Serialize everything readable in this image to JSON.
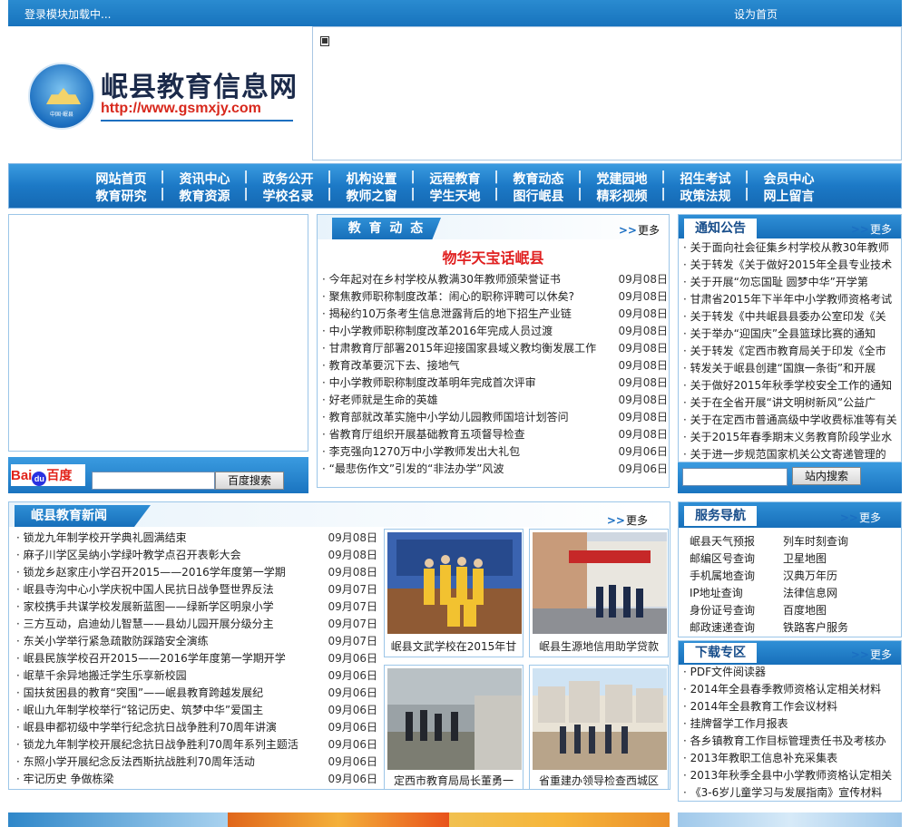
{
  "topbar": {
    "login_status": "登录模块加载中...",
    "set_home": "设为首页"
  },
  "site": {
    "title": "岷县教育信息网",
    "url": "http://www.gsmxjy.com",
    "emblem_text": "中国·岷县"
  },
  "nav": {
    "row1": [
      "网站首页",
      "资讯中心",
      "政务公开",
      "机构设置",
      "远程教育",
      "教育动态",
      "党建园地",
      "招生考试",
      "会员中心"
    ],
    "row2": [
      "教育研究",
      "教育资源",
      "学校名录",
      "教师之窗",
      "学生天地",
      "图行岷县",
      "精彩视频",
      "政策法规",
      "网上留言"
    ]
  },
  "search": {
    "baidu_button": "百度搜索",
    "site_button": "站内搜索",
    "baidu_logo_a": "Bai",
    "baidu_logo_b": "百度"
  },
  "dynamics": {
    "title": "教 育 动 态",
    "more": "更多",
    "headline": "物华天宝话岷县",
    "items": [
      {
        "t": "今年起对在乡村学校从教满30年教师颁荣誉证书",
        "d": "09月08日"
      },
      {
        "t": "聚焦教师职称制度改革：闹心的职称评聘可以休矣?",
        "d": "09月08日"
      },
      {
        "t": "揭秘约10万条考生信息泄露背后的地下招生产业链",
        "d": "09月08日"
      },
      {
        "t": "中小学教师职称制度改革2016年完成人员过渡",
        "d": "09月08日"
      },
      {
        "t": "甘肃教育厅部署2015年迎接国家县域义教均衡发展工作",
        "d": "09月08日"
      },
      {
        "t": "教育改革要沉下去、接地气",
        "d": "09月08日"
      },
      {
        "t": "中小学教师职称制度改革明年完成首次评审",
        "d": "09月08日"
      },
      {
        "t": "好老师就是生命的英雄",
        "d": "09月08日"
      },
      {
        "t": "教育部就改革实施中小学幼儿园教师国培计划答问",
        "d": "09月08日"
      },
      {
        "t": "省教育厅组织开展基础教育五项督导检查",
        "d": "09月08日"
      },
      {
        "t": "李克强向1270万中小学教师发出大礼包",
        "d": "09月06日"
      },
      {
        "t": "“最悲伤作文”引发的“非法办学”风波",
        "d": "09月06日"
      }
    ]
  },
  "notice": {
    "title": "通知公告",
    "more": "更多",
    "items": [
      "关于面向社会征集乡村学校从教30年教师",
      "关于转发《关于做好2015年全县专业技术",
      "关于开展“勿忘国耻 圆梦中华”开学第",
      "甘肃省2015年下半年中小学教师资格考试",
      "关于转发《中共岷县县委办公室印发《关",
      "关于举办“迎国庆”全县篮球比赛的通知",
      "关于转发《定西市教育局关于印发《全市",
      "转发关于岷县创建“国旗一条街”和开展",
      "关于做好2015年秋季学校安全工作的通知",
      "关于在全省开展“讲文明树新风”公益广",
      "关于在定西市普通高级中学收费标准等有关",
      "关于2015年春季期末义务教育阶段学业水",
      "关于进一步规范国家机关公文寄递管理的"
    ]
  },
  "news": {
    "title": "岷县教育新闻",
    "more": "更多",
    "items": [
      {
        "t": "锁龙九年制学校开学典礼圆满结束",
        "d": "09月08日"
      },
      {
        "t": "麻子川学区吴纳小学绿叶教学点召开表彰大会",
        "d": "09月08日"
      },
      {
        "t": "锁龙乡赵家庄小学召开2015——2016学年度第一学期",
        "d": "09月08日"
      },
      {
        "t": "岷县寺沟中心小学庆祝中国人民抗日战争暨世界反法",
        "d": "09月07日"
      },
      {
        "t": "家校携手共谋学校发展新蓝图——绿新学区明泉小学",
        "d": "09月07日"
      },
      {
        "t": "三方互动，启迪幼儿智慧——县幼儿园开展分级分主",
        "d": "09月07日"
      },
      {
        "t": "东关小学举行紧急疏散防踩踏安全演练",
        "d": "09月07日"
      },
      {
        "t": "岷县民族学校召开2015——2016学年度第一学期开学",
        "d": "09月06日"
      },
      {
        "t": "岷草千余异地搬迁学生乐享新校园",
        "d": "09月06日"
      },
      {
        "t": "国扶贫困县的教育“突围”——岷县教育跨越发展纪",
        "d": "09月06日"
      },
      {
        "t": "岷山九年制学校举行“铭记历史、筑梦中华”爱国主",
        "d": "09月06日"
      },
      {
        "t": "岷县申都初级中学举行纪念抗日战争胜利70周年讲演",
        "d": "09月06日"
      },
      {
        "t": "锁龙九年制学校开展纪念抗日战争胜利70周年系列主题活",
        "d": "09月06日"
      },
      {
        "t": "东照小学开展纪念反法西斯抗战胜利70周年活动",
        "d": "09月06日"
      },
      {
        "t": "牢记历史 争做栋梁",
        "d": "09月06日"
      }
    ]
  },
  "photos": [
    {
      "caption": "岷县文武学校在2015年甘"
    },
    {
      "caption": "岷县生源地信用助学贷款"
    },
    {
      "caption": "定西市教育局局长董勇一"
    },
    {
      "caption": "省重建办领导检查西城区"
    }
  ],
  "service": {
    "title": "服务导航",
    "more": "更多",
    "items": [
      "岷县天气预报",
      "列车时刻查询",
      "邮编区号查询",
      "卫星地图",
      "手机属地查询",
      "汉典万年历",
      "IP地址查询",
      "法律信息网",
      "身份证号查询",
      "百度地图",
      "邮政速递查询",
      "铁路客户服务"
    ]
  },
  "download": {
    "title": "下载专区",
    "more": "更多",
    "items": [
      "PDF文件阅读器",
      "2014年全县春季教师资格认定相关材料",
      "2014年全县教育工作会议材料",
      "挂牌督学工作月报表",
      "各乡镇教育工作目标管理责任书及考核办",
      "2013年教职工信息补充采集表",
      "2013年秋季全县中小学教师资格认定相关",
      "《3-6岁儿童学习与发展指南》宣传材料"
    ]
  },
  "colors": {
    "primary_blue": "#1c79c6",
    "headline_red": "#e02020",
    "url_red": "#d8281c"
  }
}
